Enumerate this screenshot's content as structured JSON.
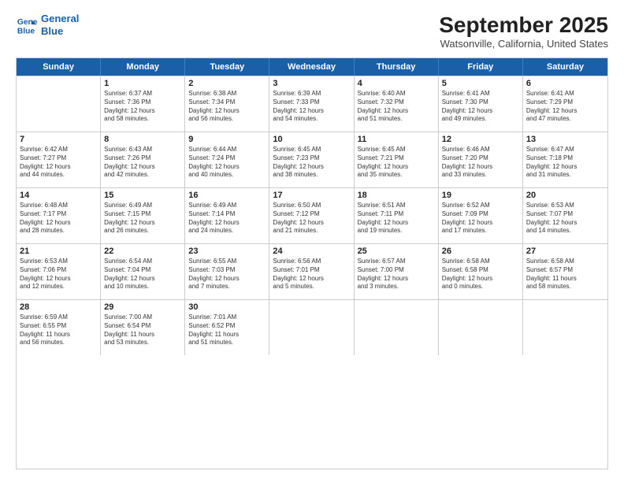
{
  "header": {
    "logo": {
      "line1": "General",
      "line2": "Blue"
    },
    "title": "September 2025",
    "subtitle": "Watsonville, California, United States"
  },
  "days_of_week": [
    "Sunday",
    "Monday",
    "Tuesday",
    "Wednesday",
    "Thursday",
    "Friday",
    "Saturday"
  ],
  "weeks": [
    [
      {
        "day": "",
        "info": ""
      },
      {
        "day": "1",
        "info": "Sunrise: 6:37 AM\nSunset: 7:36 PM\nDaylight: 12 hours\nand 58 minutes."
      },
      {
        "day": "2",
        "info": "Sunrise: 6:38 AM\nSunset: 7:34 PM\nDaylight: 12 hours\nand 56 minutes."
      },
      {
        "day": "3",
        "info": "Sunrise: 6:39 AM\nSunset: 7:33 PM\nDaylight: 12 hours\nand 54 minutes."
      },
      {
        "day": "4",
        "info": "Sunrise: 6:40 AM\nSunset: 7:32 PM\nDaylight: 12 hours\nand 51 minutes."
      },
      {
        "day": "5",
        "info": "Sunrise: 6:41 AM\nSunset: 7:30 PM\nDaylight: 12 hours\nand 49 minutes."
      },
      {
        "day": "6",
        "info": "Sunrise: 6:41 AM\nSunset: 7:29 PM\nDaylight: 12 hours\nand 47 minutes."
      }
    ],
    [
      {
        "day": "7",
        "info": "Sunrise: 6:42 AM\nSunset: 7:27 PM\nDaylight: 12 hours\nand 44 minutes."
      },
      {
        "day": "8",
        "info": "Sunrise: 6:43 AM\nSunset: 7:26 PM\nDaylight: 12 hours\nand 42 minutes."
      },
      {
        "day": "9",
        "info": "Sunrise: 6:44 AM\nSunset: 7:24 PM\nDaylight: 12 hours\nand 40 minutes."
      },
      {
        "day": "10",
        "info": "Sunrise: 6:45 AM\nSunset: 7:23 PM\nDaylight: 12 hours\nand 38 minutes."
      },
      {
        "day": "11",
        "info": "Sunrise: 6:45 AM\nSunset: 7:21 PM\nDaylight: 12 hours\nand 35 minutes."
      },
      {
        "day": "12",
        "info": "Sunrise: 6:46 AM\nSunset: 7:20 PM\nDaylight: 12 hours\nand 33 minutes."
      },
      {
        "day": "13",
        "info": "Sunrise: 6:47 AM\nSunset: 7:18 PM\nDaylight: 12 hours\nand 31 minutes."
      }
    ],
    [
      {
        "day": "14",
        "info": "Sunrise: 6:48 AM\nSunset: 7:17 PM\nDaylight: 12 hours\nand 28 minutes."
      },
      {
        "day": "15",
        "info": "Sunrise: 6:49 AM\nSunset: 7:15 PM\nDaylight: 12 hours\nand 26 minutes."
      },
      {
        "day": "16",
        "info": "Sunrise: 6:49 AM\nSunset: 7:14 PM\nDaylight: 12 hours\nand 24 minutes."
      },
      {
        "day": "17",
        "info": "Sunrise: 6:50 AM\nSunset: 7:12 PM\nDaylight: 12 hours\nand 21 minutes."
      },
      {
        "day": "18",
        "info": "Sunrise: 6:51 AM\nSunset: 7:11 PM\nDaylight: 12 hours\nand 19 minutes."
      },
      {
        "day": "19",
        "info": "Sunrise: 6:52 AM\nSunset: 7:09 PM\nDaylight: 12 hours\nand 17 minutes."
      },
      {
        "day": "20",
        "info": "Sunrise: 6:53 AM\nSunset: 7:07 PM\nDaylight: 12 hours\nand 14 minutes."
      }
    ],
    [
      {
        "day": "21",
        "info": "Sunrise: 6:53 AM\nSunset: 7:06 PM\nDaylight: 12 hours\nand 12 minutes."
      },
      {
        "day": "22",
        "info": "Sunrise: 6:54 AM\nSunset: 7:04 PM\nDaylight: 12 hours\nand 10 minutes."
      },
      {
        "day": "23",
        "info": "Sunrise: 6:55 AM\nSunset: 7:03 PM\nDaylight: 12 hours\nand 7 minutes."
      },
      {
        "day": "24",
        "info": "Sunrise: 6:56 AM\nSunset: 7:01 PM\nDaylight: 12 hours\nand 5 minutes."
      },
      {
        "day": "25",
        "info": "Sunrise: 6:57 AM\nSunset: 7:00 PM\nDaylight: 12 hours\nand 3 minutes."
      },
      {
        "day": "26",
        "info": "Sunrise: 6:58 AM\nSunset: 6:58 PM\nDaylight: 12 hours\nand 0 minutes."
      },
      {
        "day": "27",
        "info": "Sunrise: 6:58 AM\nSunset: 6:57 PM\nDaylight: 11 hours\nand 58 minutes."
      }
    ],
    [
      {
        "day": "28",
        "info": "Sunrise: 6:59 AM\nSunset: 6:55 PM\nDaylight: 11 hours\nand 56 minutes."
      },
      {
        "day": "29",
        "info": "Sunrise: 7:00 AM\nSunset: 6:54 PM\nDaylight: 11 hours\nand 53 minutes."
      },
      {
        "day": "30",
        "info": "Sunrise: 7:01 AM\nSunset: 6:52 PM\nDaylight: 11 hours\nand 51 minutes."
      },
      {
        "day": "",
        "info": ""
      },
      {
        "day": "",
        "info": ""
      },
      {
        "day": "",
        "info": ""
      },
      {
        "day": "",
        "info": ""
      }
    ]
  ]
}
